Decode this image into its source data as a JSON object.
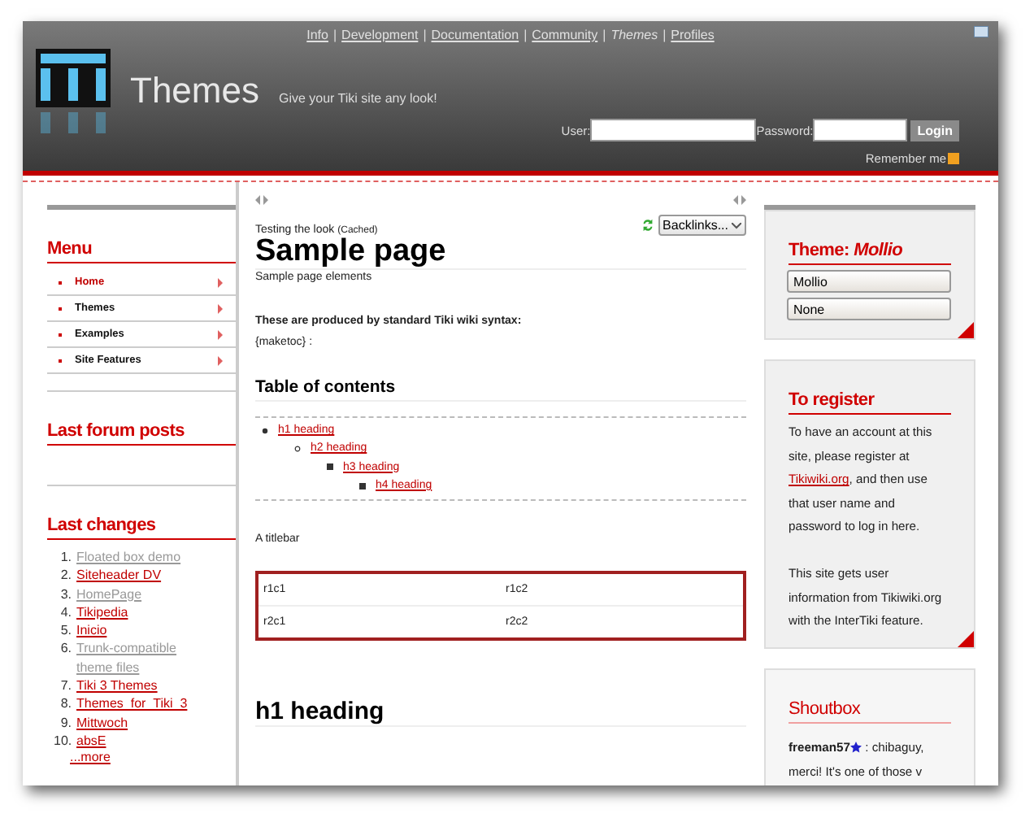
{
  "nav_separator": "|",
  "top_nav": [
    {
      "label": "Info",
      "selected": false
    },
    {
      "label": "Development",
      "selected": false
    },
    {
      "label": "Documentation",
      "selected": false
    },
    {
      "label": "Community",
      "selected": false
    },
    {
      "label": "Themes",
      "selected": true
    },
    {
      "label": "Profiles",
      "selected": false
    }
  ],
  "site": {
    "title": "Themes",
    "slogan": "Give your Tiki site any look!"
  },
  "login": {
    "user_label": "User:",
    "password_label": "Password:",
    "button": "Login",
    "remember_label": "Remember me",
    "remember_checked": true
  },
  "menu": {
    "title": "Menu",
    "items": [
      {
        "label": "Home",
        "selected": true
      },
      {
        "label": "Themes",
        "selected": false
      },
      {
        "label": "Examples",
        "selected": false
      },
      {
        "label": "Site Features",
        "selected": false
      }
    ]
  },
  "forum": {
    "title": "Last forum posts"
  },
  "last_changes": {
    "title": "Last changes",
    "items": [
      {
        "number": "1.",
        "label": "Floated box demo",
        "visited": true
      },
      {
        "number": "2.",
        "label": "Siteheader DV",
        "visited": false
      },
      {
        "number": "3.",
        "label": "HomePage",
        "visited": true
      },
      {
        "number": "4.",
        "label": "Tikipedia",
        "visited": false
      },
      {
        "number": "5.",
        "label": "Inicio",
        "visited": false
      },
      {
        "number": "6.",
        "label": "Trunk-compatible theme files",
        "visited": true
      },
      {
        "number": "7.",
        "label": "Tiki 3 Themes",
        "visited": false
      },
      {
        "number": "8.",
        "label": "Themes_for_Tiki_3",
        "visited": false
      },
      {
        "number": "9.",
        "label": "Mittwoch",
        "visited": false
      },
      {
        "number": "10.",
        "label": "absE",
        "visited": false
      }
    ],
    "more": "...more"
  },
  "page": {
    "category": "Testing the look",
    "cached": "(Cached)",
    "backlinks": "Backlinks...",
    "title": "Sample page",
    "description": "Sample page elements",
    "intro": "These are produced by standard Tiki wiki syntax:",
    "maketoc": "{maketoc} :",
    "toc_title": "Table of contents",
    "toc": [
      {
        "label": "h1 heading",
        "children": [
          {
            "label": "h2 heading",
            "children": [
              {
                "label": "h3 heading",
                "children": [
                  {
                    "label": "h4 heading"
                  }
                ]
              }
            ]
          }
        ]
      }
    ],
    "titlebar": "A titlebar",
    "table": {
      "rows": [
        [
          "r1c1",
          "r1c2"
        ],
        [
          "r2c1",
          "r2c2"
        ]
      ]
    },
    "h1": "h1 heading"
  },
  "theme_box": {
    "title": "Theme: *Mollio*",
    "selects": [
      "Mollio",
      "None"
    ]
  },
  "register": {
    "title": "To register",
    "text_before": "To have an account at this site, please register at",
    "link": "Tikiwiki.org",
    "text_after": ", and then use that user name and password to log in here.",
    "info": "This site gets user information from Tikiwiki.org with the InterTiki feature."
  },
  "shoutbox": {
    "title": "Shoutbox",
    "author": "freeman57",
    "message": ": chibaguy, merci! It's one of those v"
  }
}
